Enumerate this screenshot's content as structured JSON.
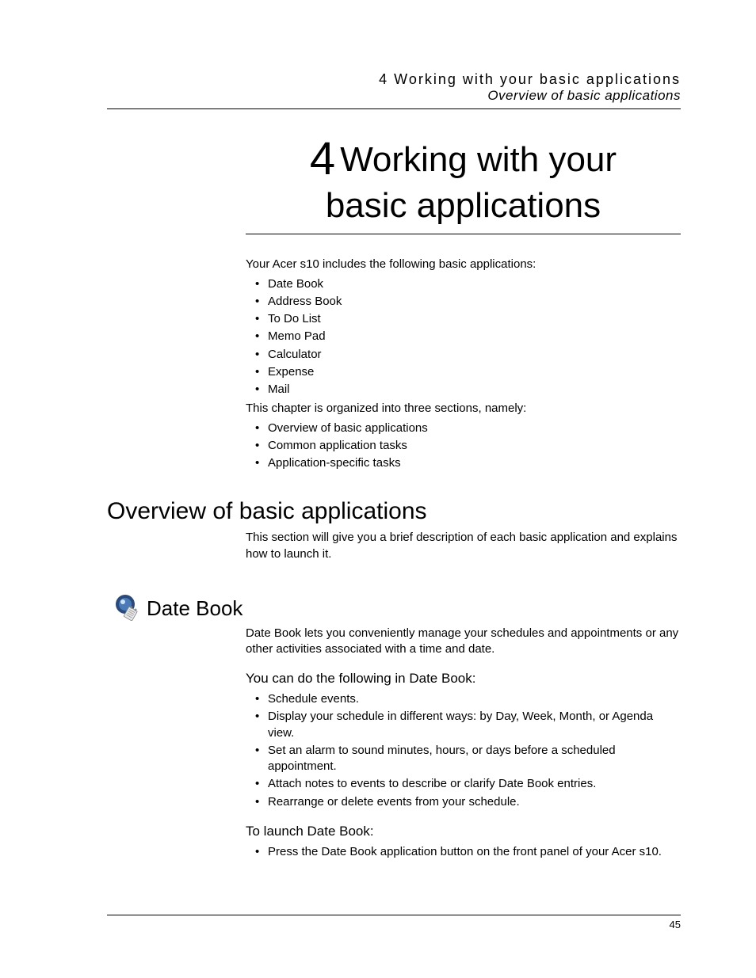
{
  "header": {
    "line1": "4 Working with your basic applications",
    "line2": "Overview of basic applications"
  },
  "chapter": {
    "number": "4",
    "title_line1": "Working with your",
    "title_line2": "basic applications"
  },
  "intro": {
    "p1": "Your Acer s10 includes the following basic applications:",
    "apps": [
      "Date Book",
      "Address Book",
      "To Do List",
      "Memo Pad",
      "Calculator",
      "Expense",
      "Mail"
    ],
    "p2": "This chapter is organized into three sections, namely:",
    "sections": [
      "Overview of basic applications",
      "Common application tasks",
      "Application-specific tasks"
    ]
  },
  "overview": {
    "heading": "Overview of basic applications",
    "p1": "This section will give you a brief description of each basic application and explains how to launch it."
  },
  "datebook": {
    "heading": "Date Book",
    "p1": "Date Book lets you conveniently manage your schedules and appointments or any other activities associated with a time and date.",
    "sub1": "You can do the following in Date Book:",
    "features": [
      "Schedule events.",
      "Display your schedule in different ways: by Day, Week, Month, or Agenda view.",
      "Set an alarm to sound minutes, hours, or days before a scheduled appointment.",
      "Attach notes to events to describe or clarify Date Book entries.",
      "Rearrange or delete events from your schedule."
    ],
    "sub2": "To launch Date Book:",
    "launch": [
      "Press the Date Book application button on the front panel of your Acer s10."
    ]
  },
  "page_number": "45"
}
